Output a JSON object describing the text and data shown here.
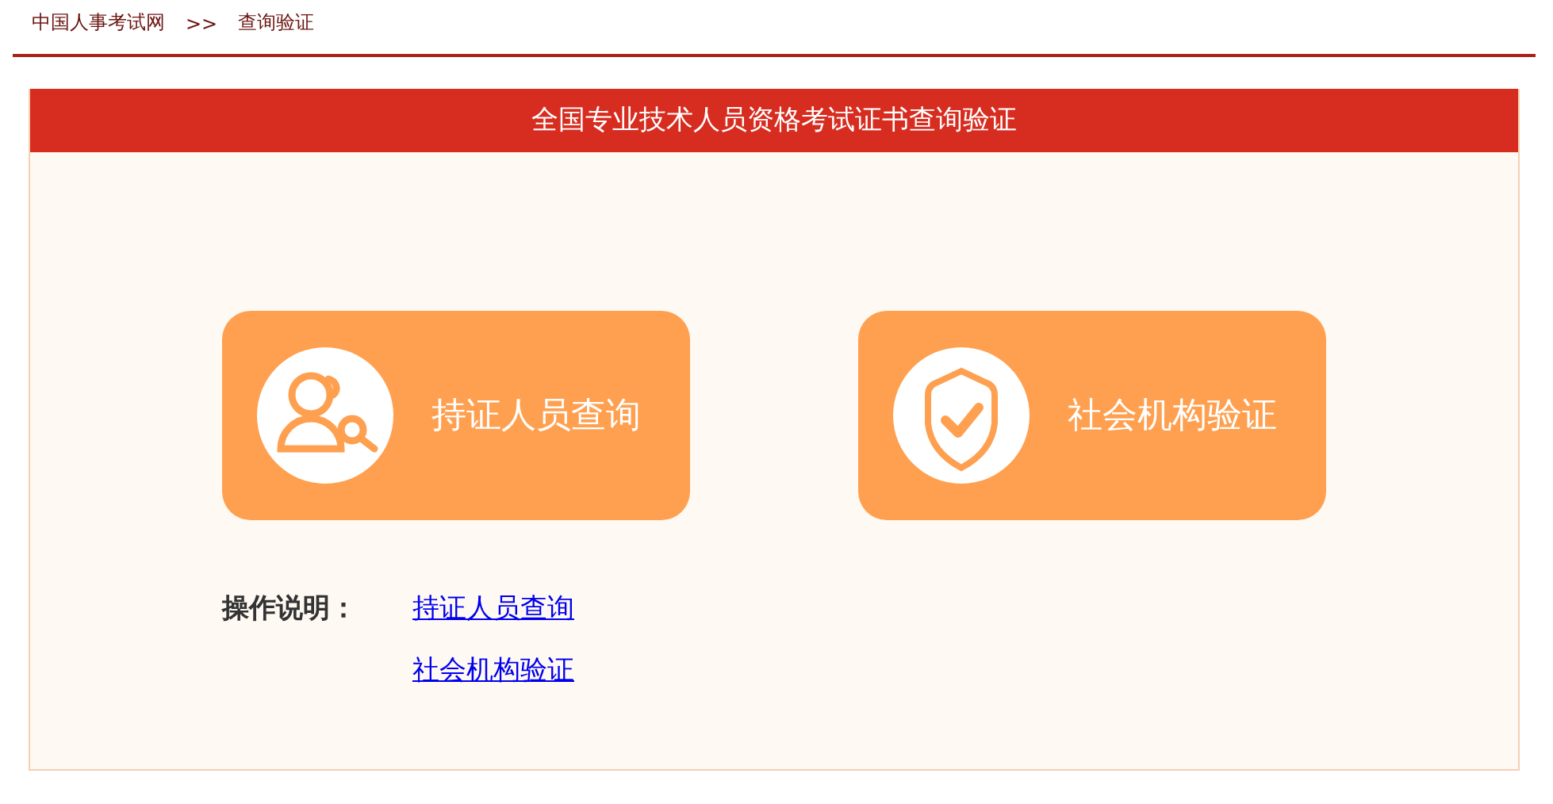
{
  "breadcrumb": {
    "items": [
      "中国人事考试网",
      "查询验证"
    ],
    "separator": ">>"
  },
  "panel": {
    "title": "全国专业技术人员资格考试证书查询验证"
  },
  "cards": [
    {
      "kind": "people",
      "label": "持证人员查询"
    },
    {
      "kind": "shield",
      "label": "社会机构验证"
    }
  ],
  "instructions": {
    "label": "操作说明：",
    "links": [
      "持证人员查询",
      "社会机构验证"
    ]
  }
}
